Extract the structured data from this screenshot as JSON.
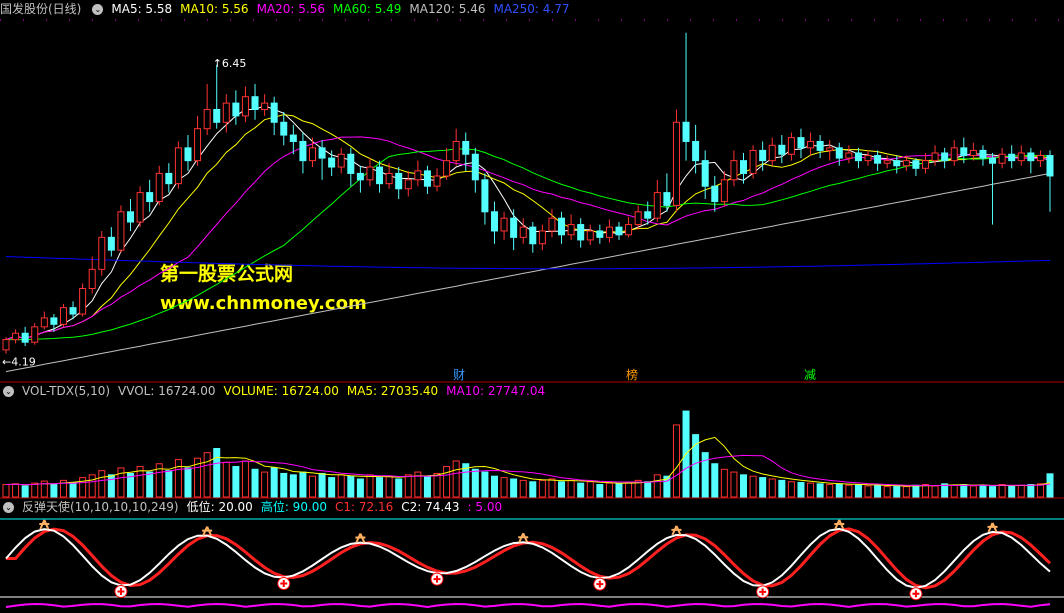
{
  "header_main": {
    "title": "国发股份(日线)",
    "items": [
      {
        "label": "MA5: 5.58",
        "color": "#ffffff"
      },
      {
        "label": "MA10: 5.56",
        "color": "#ffff00"
      },
      {
        "label": "MA20: 5.56",
        "color": "#ff00ff"
      },
      {
        "label": "MA60: 5.49",
        "color": "#00ff00"
      },
      {
        "label": "MA120: 5.46",
        "color": "#c0c0c0"
      },
      {
        "label": "MA250: 4.77",
        "color": "#0000ff"
      }
    ]
  },
  "header_vol": {
    "title": "VOL-TDX(5,10)",
    "items": [
      {
        "label": "VVOL: 16724.00",
        "color": "#c0c0c0"
      },
      {
        "label": "VOLUME: 16724.00",
        "color": "#ffff00"
      },
      {
        "label": "MA5: 27035.40",
        "color": "#ffff00"
      },
      {
        "label": "MA10: 27747.04",
        "color": "#ff00ff"
      }
    ]
  },
  "header_ind": {
    "title": "反弹天使(10,10,10,10,249)",
    "items": [
      {
        "label": "低位: 20.00",
        "color": "#ffffff"
      },
      {
        "label": "高位: 90.00",
        "color": "#00ffff"
      },
      {
        "label": "C1: 72.16",
        "color": "#ff0000"
      },
      {
        "label": "C2: 74.43",
        "color": "#ffffff"
      },
      {
        "label": ": 5.00",
        "color": "#ff00ff"
      }
    ]
  },
  "watermark": {
    "line1": "第一股票公式网",
    "line2": "www.chnmoney.com"
  },
  "events": [
    {
      "label": "财",
      "color": "#3399ff"
    },
    {
      "label": "榜",
      "color": "#ff9900"
    },
    {
      "label": "减",
      "color": "#00ff00"
    }
  ],
  "colors": {
    "up": "#ff3232",
    "down": "#54ffff",
    "axis": "#b00000"
  },
  "chart_data": [
    {
      "type": "candlestick",
      "ylim": [
        4.0,
        6.8
      ],
      "annotations": {
        "high": "6.45",
        "low": "4.19"
      },
      "series": [
        {
          "name": "MA5",
          "color": "#ffffff"
        },
        {
          "name": "MA10",
          "color": "#ffff00"
        },
        {
          "name": "MA20",
          "color": "#ff00ff"
        },
        {
          "name": "MA60",
          "color": "#00ff00"
        },
        {
          "name": "MA120",
          "color": "#c0c0c0"
        },
        {
          "name": "MA250",
          "color": "#0000ff"
        }
      ],
      "candles": [
        [
          4.22,
          4.3,
          4.32,
          4.19
        ],
        [
          4.3,
          4.35,
          4.38,
          4.27
        ],
        [
          4.35,
          4.28,
          4.4,
          4.25
        ],
        [
          4.28,
          4.4,
          4.43,
          4.26
        ],
        [
          4.4,
          4.47,
          4.52,
          4.38
        ],
        [
          4.47,
          4.42,
          4.5,
          4.36
        ],
        [
          4.42,
          4.55,
          4.58,
          4.4
        ],
        [
          4.55,
          4.5,
          4.6,
          4.46
        ],
        [
          4.5,
          4.7,
          4.74,
          4.48
        ],
        [
          4.7,
          4.85,
          4.95,
          4.66
        ],
        [
          4.85,
          5.1,
          5.15,
          4.8
        ],
        [
          5.1,
          5.0,
          5.18,
          4.95
        ],
        [
          5.0,
          5.3,
          5.35,
          4.98
        ],
        [
          5.3,
          5.22,
          5.4,
          5.15
        ],
        [
          5.22,
          5.45,
          5.5,
          5.18
        ],
        [
          5.45,
          5.38,
          5.55,
          5.3
        ],
        [
          5.38,
          5.6,
          5.66,
          5.35
        ],
        [
          5.6,
          5.52,
          5.68,
          5.45
        ],
        [
          5.52,
          5.8,
          5.85,
          5.48
        ],
        [
          5.8,
          5.7,
          5.9,
          5.62
        ],
        [
          5.7,
          5.95,
          6.05,
          5.66
        ],
        [
          5.95,
          6.1,
          6.3,
          5.9
        ],
        [
          6.1,
          6.0,
          6.45,
          5.95
        ],
        [
          6.0,
          6.15,
          6.22,
          5.92
        ],
        [
          6.15,
          6.05,
          6.25,
          5.98
        ],
        [
          6.05,
          6.2,
          6.28,
          6.0
        ],
        [
          6.2,
          6.1,
          6.3,
          6.02
        ],
        [
          6.1,
          6.15,
          6.22,
          6.05
        ],
        [
          6.15,
          6.0,
          6.2,
          5.9
        ],
        [
          6.0,
          5.9,
          6.08,
          5.82
        ],
        [
          5.9,
          5.85,
          5.98,
          5.75
        ],
        [
          5.85,
          5.7,
          5.92,
          5.6
        ],
        [
          5.7,
          5.8,
          5.88,
          5.65
        ],
        [
          5.8,
          5.72,
          5.86,
          5.55
        ],
        [
          5.72,
          5.65,
          5.78,
          5.58
        ],
        [
          5.65,
          5.75,
          5.8,
          5.6
        ],
        [
          5.75,
          5.6,
          5.8,
          5.5
        ],
        [
          5.6,
          5.55,
          5.66,
          5.45
        ],
        [
          5.55,
          5.65,
          5.72,
          5.5
        ],
        [
          5.65,
          5.52,
          5.7,
          5.45
        ],
        [
          5.52,
          5.6,
          5.68,
          5.48
        ],
        [
          5.6,
          5.48,
          5.65,
          5.4
        ],
        [
          5.48,
          5.55,
          5.62,
          5.42
        ],
        [
          5.55,
          5.62,
          5.7,
          5.5
        ],
        [
          5.62,
          5.5,
          5.66,
          5.44
        ],
        [
          5.5,
          5.58,
          5.64,
          5.46
        ],
        [
          5.58,
          5.7,
          5.8,
          5.55
        ],
        [
          5.7,
          5.85,
          5.95,
          5.66
        ],
        [
          5.85,
          5.75,
          5.92,
          5.62
        ],
        [
          5.75,
          5.55,
          5.8,
          5.45
        ],
        [
          5.55,
          5.3,
          5.6,
          5.2
        ],
        [
          5.3,
          5.15,
          5.38,
          5.05
        ],
        [
          5.15,
          5.25,
          5.3,
          5.08
        ],
        [
          5.25,
          5.1,
          5.32,
          5.0
        ],
        [
          5.1,
          5.18,
          5.25,
          5.05
        ],
        [
          5.18,
          5.05,
          5.22,
          4.98
        ],
        [
          5.05,
          5.15,
          5.2,
          5.0
        ],
        [
          5.15,
          5.25,
          5.32,
          5.1
        ],
        [
          5.25,
          5.12,
          5.3,
          5.05
        ],
        [
          5.12,
          5.2,
          5.28,
          5.08
        ],
        [
          5.2,
          5.08,
          5.25,
          5.02
        ],
        [
          5.08,
          5.15,
          5.2,
          5.04
        ],
        [
          5.15,
          5.1,
          5.2,
          5.05
        ],
        [
          5.1,
          5.18,
          5.24,
          5.06
        ],
        [
          5.18,
          5.12,
          5.22,
          5.08
        ],
        [
          5.12,
          5.2,
          5.26,
          5.1
        ],
        [
          5.2,
          5.3,
          5.35,
          5.16
        ],
        [
          5.3,
          5.25,
          5.38,
          5.2
        ],
        [
          5.25,
          5.45,
          5.55,
          5.22
        ],
        [
          5.45,
          5.35,
          5.6,
          5.3
        ],
        [
          5.35,
          6.0,
          6.1,
          5.3
        ],
        [
          6.0,
          5.85,
          6.7,
          5.7
        ],
        [
          5.85,
          5.7,
          5.98,
          5.6
        ],
        [
          5.7,
          5.5,
          5.78,
          5.4
        ],
        [
          5.5,
          5.38,
          5.58,
          5.3
        ],
        [
          5.38,
          5.55,
          5.62,
          5.34
        ],
        [
          5.55,
          5.7,
          5.78,
          5.5
        ],
        [
          5.7,
          5.6,
          5.76,
          5.52
        ],
        [
          5.6,
          5.78,
          5.82,
          5.56
        ],
        [
          5.78,
          5.7,
          5.85,
          5.62
        ],
        [
          5.7,
          5.82,
          5.88,
          5.66
        ],
        [
          5.82,
          5.75,
          5.9,
          5.68
        ],
        [
          5.75,
          5.88,
          5.92,
          5.7
        ],
        [
          5.88,
          5.8,
          5.95,
          5.72
        ],
        [
          5.8,
          5.85,
          5.92,
          5.74
        ],
        [
          5.85,
          5.78,
          5.9,
          5.72
        ],
        [
          5.78,
          5.8,
          5.86,
          5.7
        ],
        [
          5.8,
          5.72,
          5.84,
          5.66
        ],
        [
          5.72,
          5.76,
          5.82,
          5.68
        ],
        [
          5.76,
          5.7,
          5.8,
          5.64
        ],
        [
          5.7,
          5.74,
          5.78,
          5.66
        ],
        [
          5.74,
          5.68,
          5.78,
          5.62
        ],
        [
          5.68,
          5.7,
          5.74,
          5.64
        ],
        [
          5.7,
          5.66,
          5.74,
          5.6
        ],
        [
          5.66,
          5.7,
          5.74,
          5.62
        ],
        [
          5.7,
          5.64,
          5.72,
          5.58
        ],
        [
          5.64,
          5.7,
          5.76,
          5.6
        ],
        [
          5.7,
          5.76,
          5.82,
          5.66
        ],
        [
          5.76,
          5.7,
          5.8,
          5.64
        ],
        [
          5.7,
          5.8,
          5.86,
          5.66
        ],
        [
          5.8,
          5.74,
          5.88,
          5.68
        ],
        [
          5.74,
          5.78,
          5.84,
          5.7
        ],
        [
          5.78,
          5.72,
          5.82,
          5.66
        ],
        [
          5.72,
          5.68,
          5.76,
          5.2
        ],
        [
          5.68,
          5.75,
          5.8,
          5.64
        ],
        [
          5.75,
          5.7,
          5.82,
          5.64
        ],
        [
          5.7,
          5.76,
          5.82,
          5.66
        ],
        [
          5.76,
          5.7,
          5.8,
          5.6
        ],
        [
          5.7,
          5.74,
          5.78,
          5.65
        ],
        [
          5.74,
          5.58,
          5.78,
          5.3
        ]
      ]
    },
    {
      "type": "bar",
      "ylim": [
        0,
        70000
      ],
      "values": [
        9000,
        9500,
        8000,
        10000,
        11500,
        9000,
        12000,
        10500,
        14000,
        16000,
        19000,
        16000,
        21000,
        17000,
        22000,
        18000,
        24000,
        19000,
        27000,
        21000,
        28000,
        32000,
        35000,
        25000,
        22000,
        26000,
        20000,
        18000,
        21000,
        17000,
        16000,
        18000,
        15000,
        17000,
        14000,
        16000,
        15000,
        13000,
        16000,
        14000,
        15000,
        13000,
        16000,
        18000,
        15000,
        17000,
        22000,
        26000,
        24000,
        20000,
        18000,
        15000,
        14000,
        13000,
        12000,
        11000,
        12000,
        13000,
        11000,
        12000,
        10000,
        11000,
        9000,
        10000,
        9500,
        10500,
        12000,
        11000,
        16000,
        15000,
        52000,
        62000,
        45000,
        32000,
        24000,
        20000,
        18000,
        16000,
        15000,
        14000,
        13000,
        12000,
        11000,
        10500,
        10000,
        9500,
        9000,
        9500,
        8500,
        9000,
        8000,
        8500,
        7500,
        8000,
        7500,
        8500,
        9000,
        8000,
        9500,
        8500,
        9000,
        8000,
        8500,
        7500,
        9000,
        8000,
        8500,
        9000,
        9500,
        16724
      ]
    }
  ]
}
